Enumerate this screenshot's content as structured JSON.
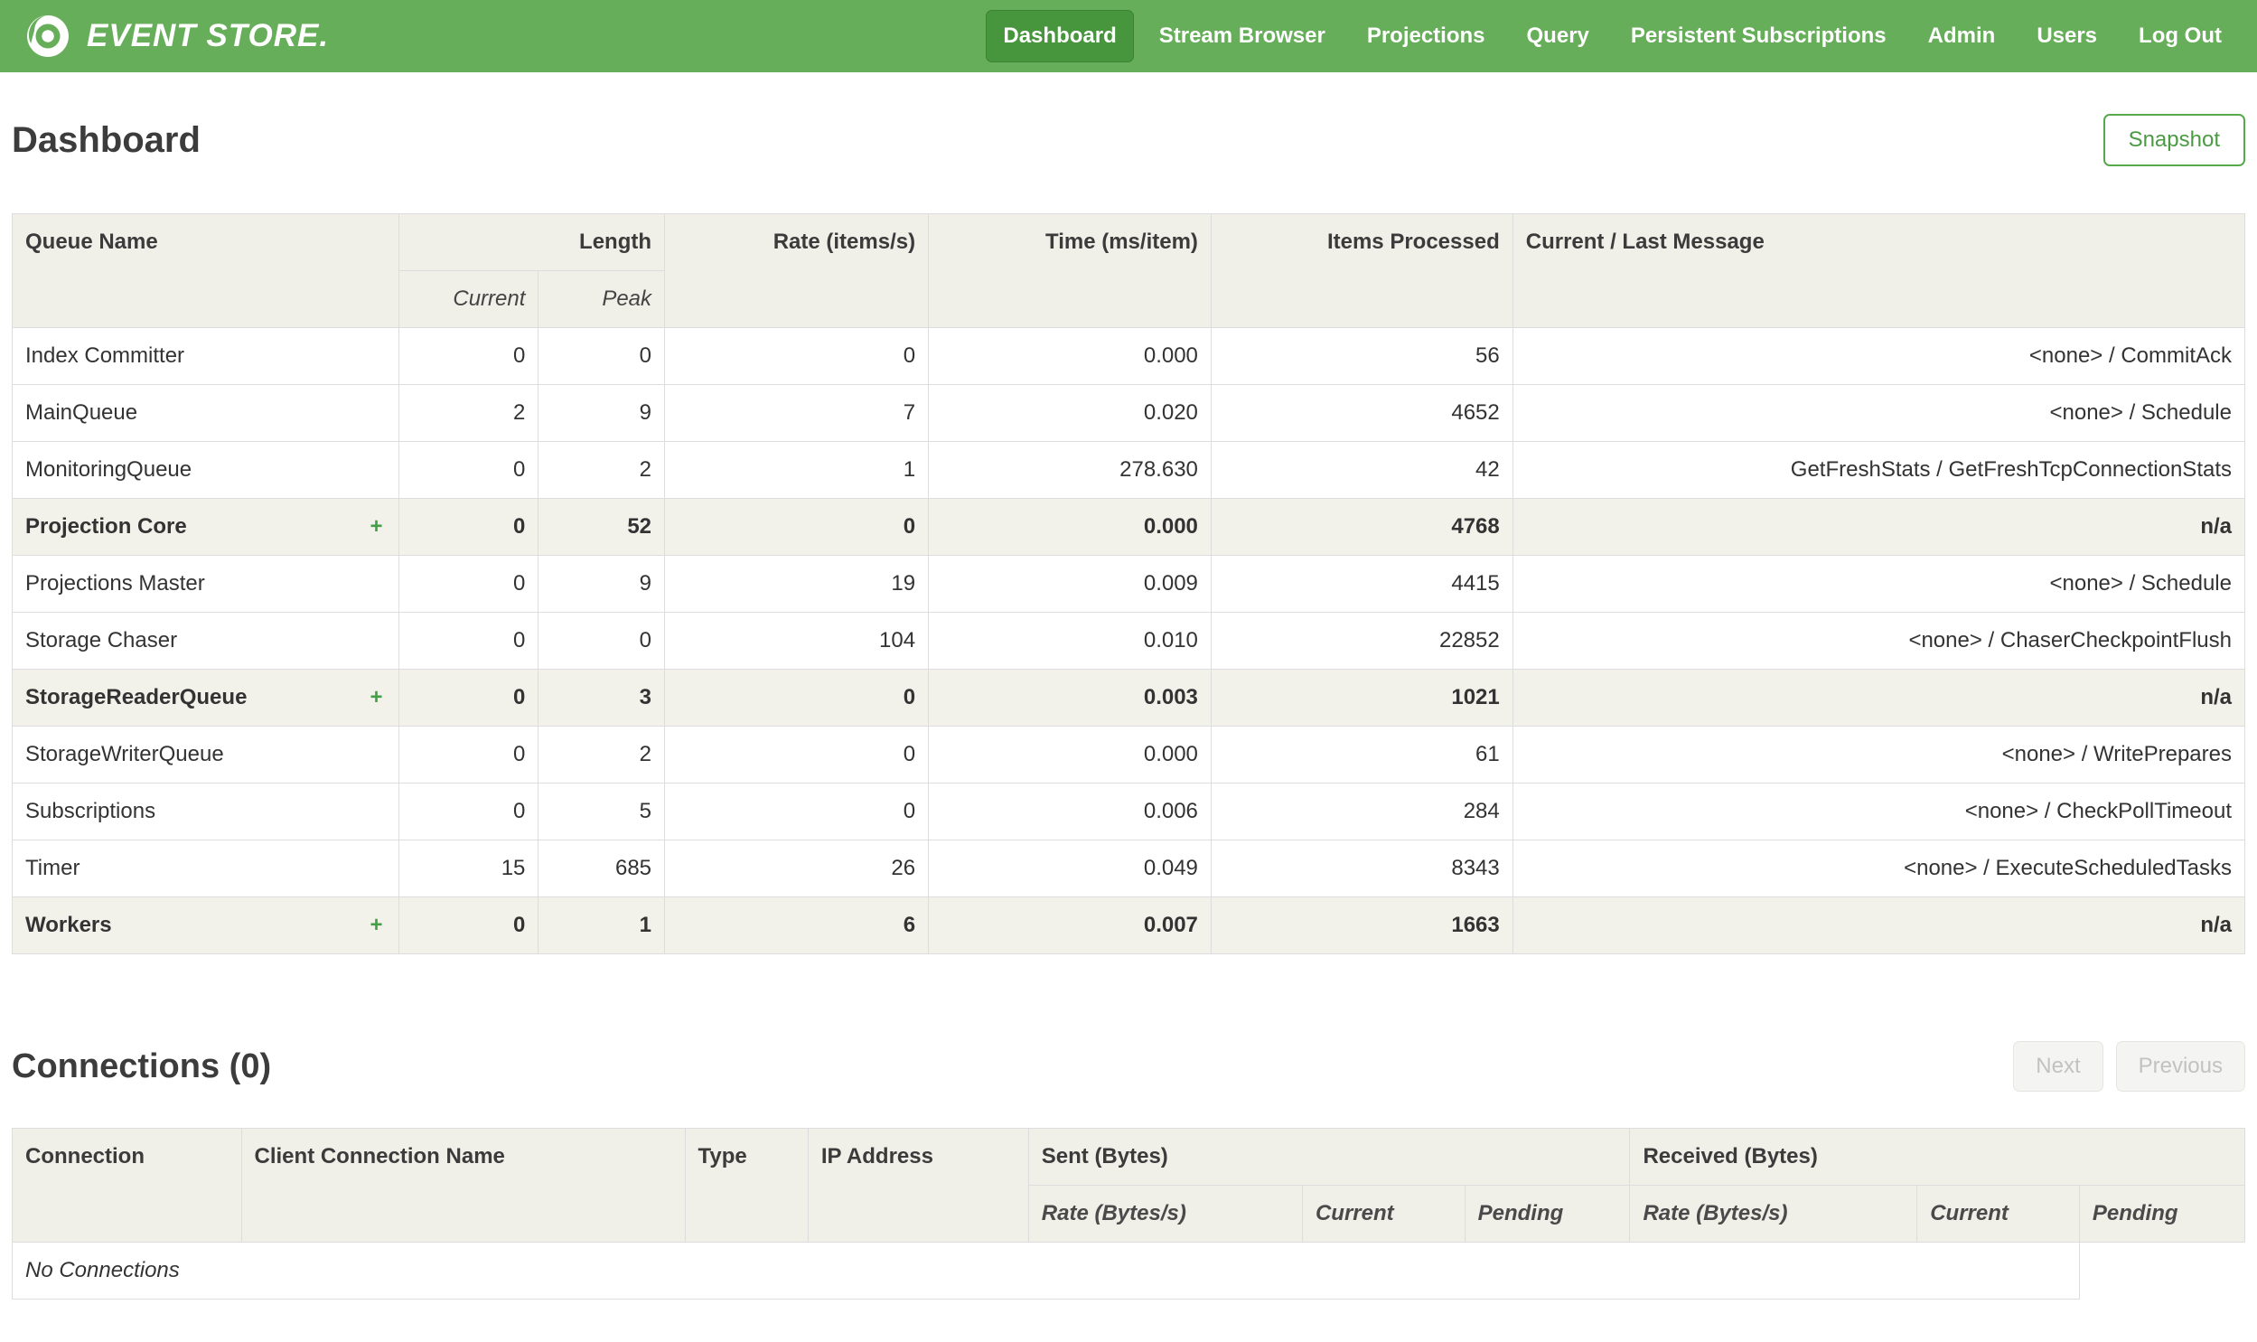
{
  "colors": {
    "navbar_green": "#67ae5a",
    "active_nav_green": "#47953c",
    "accent_green": "#43a047",
    "header_cell_bg": "#f0efe8",
    "group_row_bg": "#f2f1ea"
  },
  "nav": {
    "brand": "EVENT STORE.",
    "items": [
      {
        "label": "Dashboard",
        "active": true
      },
      {
        "label": "Stream Browser",
        "active": false
      },
      {
        "label": "Projections",
        "active": false
      },
      {
        "label": "Query",
        "active": false
      },
      {
        "label": "Persistent Subscriptions",
        "active": false
      },
      {
        "label": "Admin",
        "active": false
      },
      {
        "label": "Users",
        "active": false
      },
      {
        "label": "Log Out",
        "active": false
      }
    ]
  },
  "page": {
    "title": "Dashboard",
    "snapshot_button": "Snapshot"
  },
  "queues_table": {
    "headers": {
      "queue_name": "Queue Name",
      "length": "Length",
      "current": "Current",
      "peak": "Peak",
      "rate": "Rate (items/s)",
      "time": "Time (ms/item)",
      "items_processed": "Items Processed",
      "message": "Current / Last Message"
    },
    "expand_symbol": "+",
    "rows": [
      {
        "name": "Index Committer",
        "expandable": false,
        "current": "0",
        "peak": "0",
        "rate": "0",
        "time": "0.000",
        "items": "56",
        "message": "<none> / CommitAck"
      },
      {
        "name": "MainQueue",
        "expandable": false,
        "current": "2",
        "peak": "9",
        "rate": "7",
        "time": "0.020",
        "items": "4652",
        "message": "<none> / Schedule"
      },
      {
        "name": "MonitoringQueue",
        "expandable": false,
        "current": "0",
        "peak": "2",
        "rate": "1",
        "time": "278.630",
        "items": "42",
        "message": "GetFreshStats / GetFreshTcpConnectionStats"
      },
      {
        "name": "Projection Core",
        "expandable": true,
        "current": "0",
        "peak": "52",
        "rate": "0",
        "time": "0.000",
        "items": "4768",
        "message": "n/a"
      },
      {
        "name": "Projections Master",
        "expandable": false,
        "current": "0",
        "peak": "9",
        "rate": "19",
        "time": "0.009",
        "items": "4415",
        "message": "<none> / Schedule"
      },
      {
        "name": "Storage Chaser",
        "expandable": false,
        "current": "0",
        "peak": "0",
        "rate": "104",
        "time": "0.010",
        "items": "22852",
        "message": "<none> / ChaserCheckpointFlush"
      },
      {
        "name": "StorageReaderQueue",
        "expandable": true,
        "current": "0",
        "peak": "3",
        "rate": "0",
        "time": "0.003",
        "items": "1021",
        "message": "n/a"
      },
      {
        "name": "StorageWriterQueue",
        "expandable": false,
        "current": "0",
        "peak": "2",
        "rate": "0",
        "time": "0.000",
        "items": "61",
        "message": "<none> / WritePrepares"
      },
      {
        "name": "Subscriptions",
        "expandable": false,
        "current": "0",
        "peak": "5",
        "rate": "0",
        "time": "0.006",
        "items": "284",
        "message": "<none> / CheckPollTimeout"
      },
      {
        "name": "Timer",
        "expandable": false,
        "current": "15",
        "peak": "685",
        "rate": "26",
        "time": "0.049",
        "items": "8343",
        "message": "<none> / ExecuteScheduledTasks"
      },
      {
        "name": "Workers",
        "expandable": true,
        "current": "0",
        "peak": "1",
        "rate": "6",
        "time": "0.007",
        "items": "1663",
        "message": "n/a"
      }
    ]
  },
  "connections": {
    "title": "Connections (0)",
    "next_button": "Next",
    "previous_button": "Previous",
    "headers": {
      "connection": "Connection",
      "client_connection_name": "Client Connection Name",
      "type": "Type",
      "ip_address": "IP Address",
      "sent": "Sent (Bytes)",
      "received": "Received (Bytes)",
      "rate": "Rate (Bytes/s)",
      "current": "Current",
      "pending": "Pending"
    },
    "empty_message": "No Connections"
  }
}
